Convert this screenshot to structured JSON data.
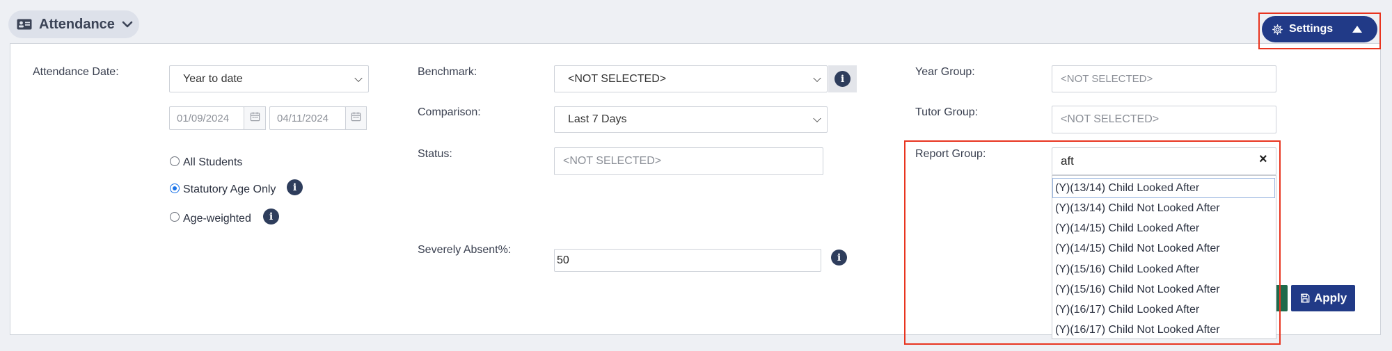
{
  "header": {
    "title": "Attendance",
    "icon": "id-card-icon"
  },
  "settings": {
    "label": "Settings"
  },
  "filters": {
    "attendance_date": {
      "label": "Attendance Date:",
      "value": "Year to date",
      "from": "01/09/2024",
      "to": "04/11/2024"
    },
    "student_scope": [
      {
        "label": "All Students",
        "selected": false
      },
      {
        "label": "Statutory Age Only",
        "selected": true
      },
      {
        "label": "Age-weighted",
        "selected": false
      }
    ],
    "benchmark": {
      "label": "Benchmark:",
      "value": "<NOT SELECTED>"
    },
    "comparison": {
      "label": "Comparison:",
      "value": "Last 7 Days"
    },
    "status": {
      "label": "Status:",
      "placeholder": "<NOT SELECTED>"
    },
    "severely_absent": {
      "label": "Severely Absent%:",
      "value": "50"
    },
    "year_group": {
      "label": "Year Group:",
      "placeholder": "<NOT SELECTED>"
    },
    "tutor_group": {
      "label": "Tutor Group:",
      "placeholder": "<NOT SELECTED>"
    },
    "report_group": {
      "label": "Report Group:",
      "search_value": "aft",
      "clear_symbol": "×",
      "options": [
        "(Y)(13/14) Child Looked After",
        "(Y)(13/14) Child Not Looked After",
        "(Y)(14/15) Child Looked After",
        "(Y)(14/15) Child Not Looked After",
        "(Y)(15/16) Child Looked After",
        "(Y)(15/16) Child Not Looked After",
        "(Y)(16/17) Child Looked After",
        "(Y)(16/17) Child Not Looked After"
      ]
    }
  },
  "actions": {
    "apply_label": "Apply"
  },
  "colors": {
    "primary": "#213a87",
    "highlight": "#e8341f",
    "info": "#2e3d5c",
    "green": "#1e6a4a"
  }
}
